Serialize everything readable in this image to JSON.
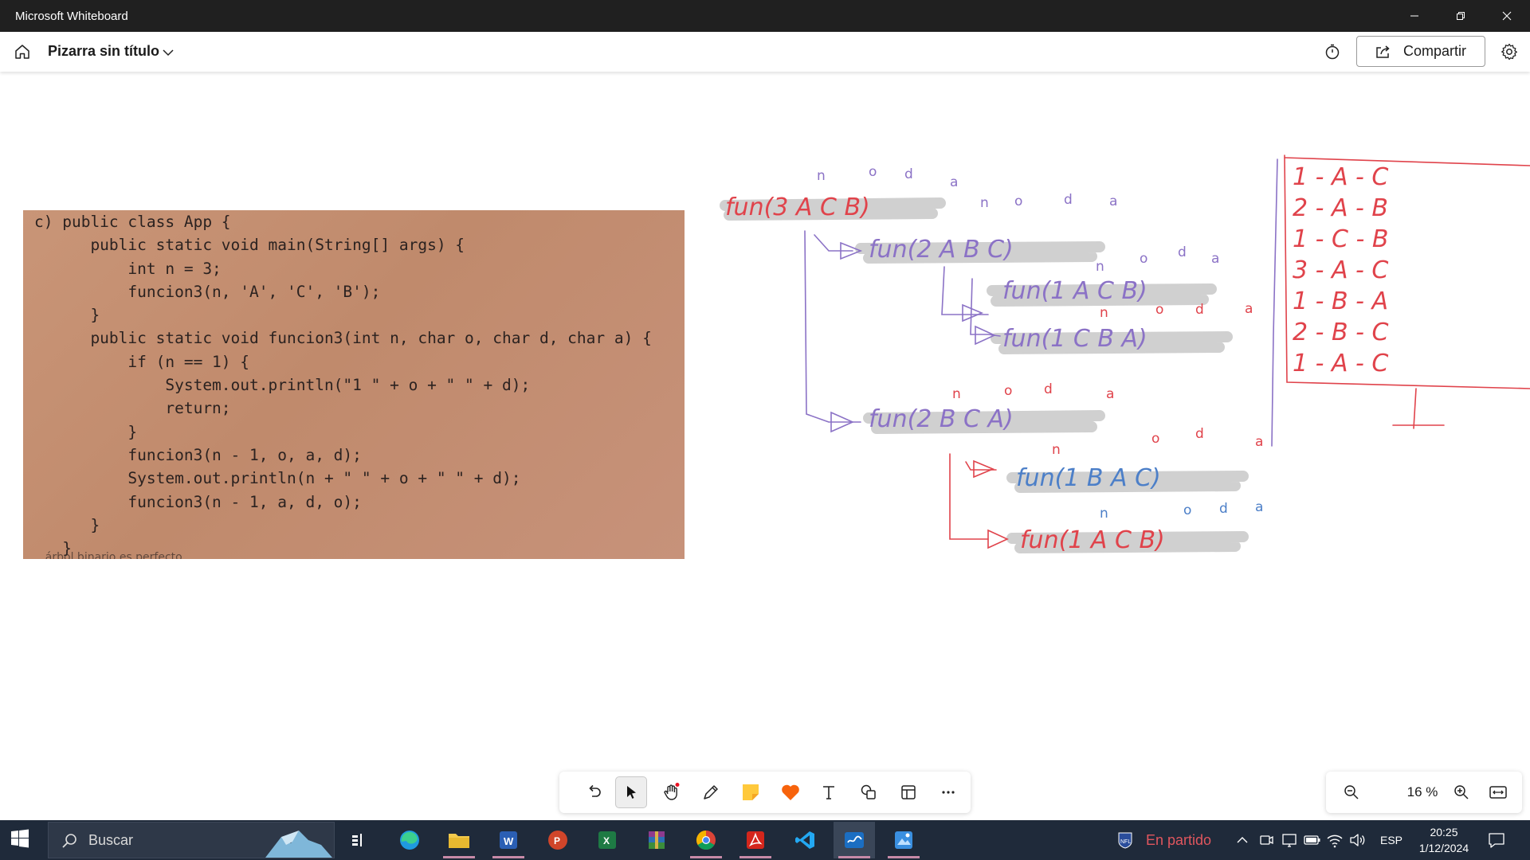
{
  "window": {
    "title": "Microsoft Whiteboard"
  },
  "header": {
    "board_title": "Pizarra sin título",
    "share_label": "Compartir"
  },
  "code_image": {
    "lines": [
      "c) public class App {",
      "      public static void main(String[] args) {",
      "          int n = 3;",
      "          funcion3(n, 'A', 'C', 'B');",
      "      }",
      "      public static void funcion3(int n, char o, char d, char a) {",
      "          if (n == 1) {",
      "              System.out.println(\"1 \" + o + \" \" + d);",
      "              return;",
      "          }",
      "          funcion3(n - 1, o, a, d);",
      "          System.out.println(n + \" \" + o + \" \" + d);",
      "          funcion3(n - 1, a, d, o);",
      "      }",
      "   }"
    ],
    "cut_footer": "... árbol binario es perfecto"
  },
  "ink": {
    "calls": [
      "fun(3 A C B)",
      "fun(2 A B C)",
      "fun(1 A C B)",
      "fun(1 C B A)",
      "fun(2 B C A)",
      "fun(1 B A C)",
      "fun(1 A C B)"
    ],
    "params": [
      "n",
      "o",
      "d",
      "a"
    ],
    "output_moves": [
      "1 - A - C",
      "2 - A - B",
      "1 - C - B",
      "3 - A - C",
      "1 - B - A",
      "2 - B - C",
      "1 - A - C"
    ],
    "colors": {
      "red": "#e0434b",
      "blue": "#4c7fc8",
      "purple": "#8b72c6",
      "highlight": "#c8c8c8"
    }
  },
  "toolbar": {
    "tools": [
      {
        "name": "undo-icon"
      },
      {
        "name": "select-icon",
        "active": true
      },
      {
        "name": "hand-icon"
      },
      {
        "name": "pen-icon"
      },
      {
        "name": "sticky-note-icon"
      },
      {
        "name": "reactions-icon"
      },
      {
        "name": "text-icon"
      },
      {
        "name": "shapes-icon"
      },
      {
        "name": "templates-icon"
      },
      {
        "name": "more-icon"
      }
    ]
  },
  "zoom": {
    "level": "16 %"
  },
  "taskbar": {
    "search_placeholder": "Buscar",
    "game_status": "En partido",
    "language": "ESP",
    "time": "20:25",
    "date": "1/12/2024"
  }
}
